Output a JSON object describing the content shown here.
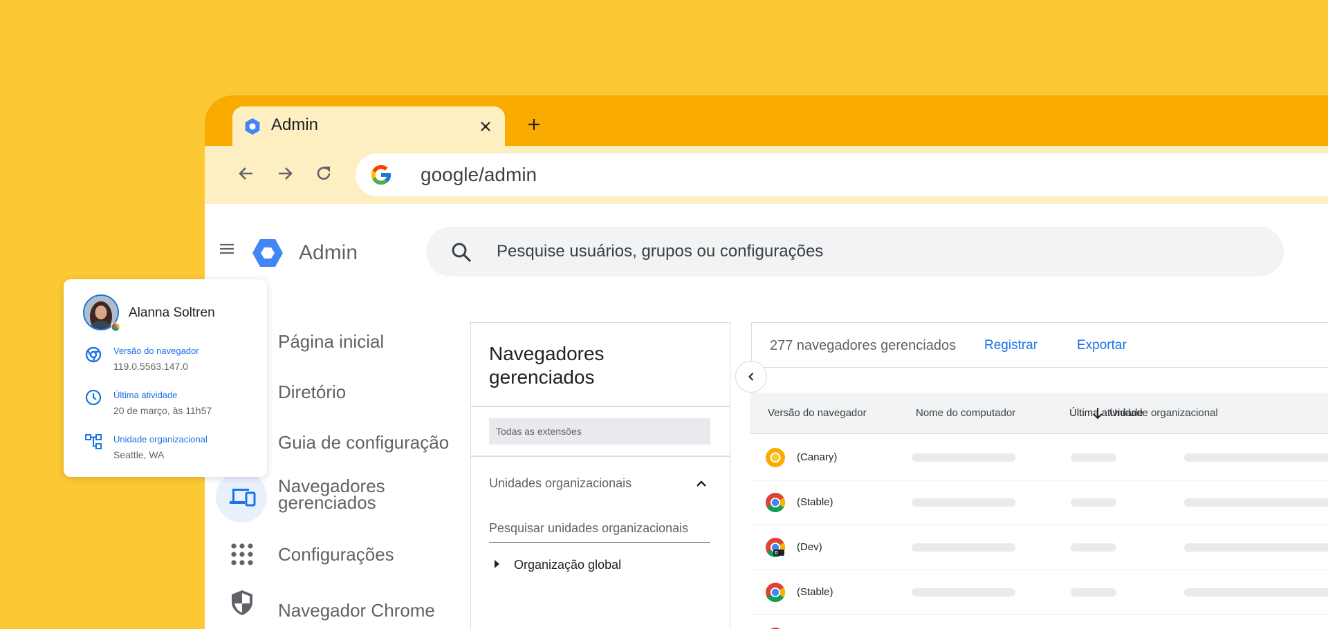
{
  "colors": {
    "background": "#fcc934",
    "tabstrip": "#f9ab00",
    "toolbar": "#feefc3",
    "accent_blue": "#1a73e8"
  },
  "browser": {
    "tab_title": "Admin",
    "url": "google/admin"
  },
  "admin": {
    "app_title": "Admin",
    "search_placeholder": "Pesquise usuários, grupos ou configurações"
  },
  "sidebar": {
    "items": [
      {
        "label": "Página inicial",
        "icon": "home-icon"
      },
      {
        "label": "Diretório",
        "icon": "directory-icon"
      },
      {
        "label": "Guia de configuração",
        "icon": "setup-guide-icon"
      },
      {
        "label": "Navegadores gerenciados",
        "icon": "devices-icon",
        "active": true
      },
      {
        "label": "Configurações",
        "icon": "apps-grid-icon"
      },
      {
        "label": "Navegador Chrome",
        "icon": "security-shield-icon"
      }
    ]
  },
  "middle_panel": {
    "title": "Navegadores gerenciados",
    "filter_chip": "Todas as extensões",
    "ou_header": "Unidades organizacionais",
    "ou_search_placeholder": "Pesquisar unidades organizacionais",
    "ou_item": "Organização global"
  },
  "main_panel": {
    "count_text": "277 navegadores gerenciados",
    "register_label": "Registrar",
    "export_label": "Exportar",
    "columns": [
      "Versão do navegador",
      "Nome do computador",
      "Última atividade",
      "Unidade organizacional"
    ],
    "rows": [
      {
        "channel": "(Canary)",
        "icon": "chrome-canary-icon"
      },
      {
        "channel": "(Stable)",
        "icon": "chrome-icon"
      },
      {
        "channel": "(Dev)",
        "icon": "chrome-dev-icon"
      },
      {
        "channel": "(Stable)",
        "icon": "chrome-icon"
      }
    ]
  },
  "profile_card": {
    "name": "Alanna Soltren",
    "browser_version_label": "Versão do navegador",
    "browser_version_value": "119.0.5563.147.0",
    "last_activity_label": "Última atividade",
    "last_activity_value": "20 de março, às 11h57",
    "org_unit_label": "Unidade organizacional",
    "org_unit_value": "Seattle, WA"
  }
}
